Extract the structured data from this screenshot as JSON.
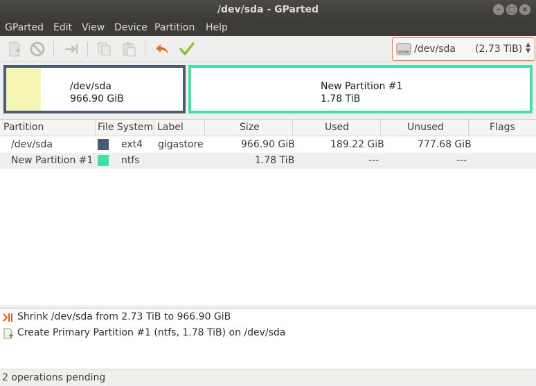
{
  "window": {
    "title": "/dev/sda - GParted"
  },
  "menu": {
    "items": [
      "GParted",
      "Edit",
      "View",
      "Device",
      "Partition",
      "Help"
    ]
  },
  "toolbar": {
    "icons": [
      "new-partition-icon",
      "delete-icon",
      "resize-move-icon",
      "copy-icon",
      "paste-icon",
      "undo-icon",
      "apply-icon"
    ]
  },
  "device_selector": {
    "name": "/dev/sda",
    "size": "(2.73 TiB)"
  },
  "disk_map": {
    "partitions": [
      {
        "name": "/dev/sda",
        "size": "966.90 GiB",
        "border_color": "#485b70",
        "used_fraction": 0.2
      },
      {
        "name": "New Partition #1",
        "size": "1.78 TiB",
        "border_color": "#43dfa8",
        "used_fraction": 0
      }
    ]
  },
  "table": {
    "columns": [
      "Partition",
      "File System",
      "Label",
      "Size",
      "Used",
      "Unused",
      "Flags"
    ],
    "rows": [
      {
        "partition": "/dev/sda",
        "fs_color": "#485b70",
        "filesystem": "ext4",
        "label": "gigastore",
        "size": "966.90 GiB",
        "used": "189.22 GiB",
        "unused": "777.68 GiB",
        "flags": ""
      },
      {
        "partition": "New Partition #1",
        "fs_color": "#43dfa8",
        "filesystem": "ntfs",
        "label": "",
        "size": "1.78 TiB",
        "used": "---",
        "unused": "---",
        "flags": ""
      }
    ]
  },
  "operations": {
    "items": [
      {
        "icon": "shrink-icon",
        "text": "Shrink /dev/sda from 2.73 TiB to 966.90 GiB"
      },
      {
        "icon": "create-partition-icon",
        "text": "Create Primary Partition #1 (ntfs, 1.78 TiB) on /dev/sda"
      }
    ]
  },
  "status": {
    "text": "2 operations pending"
  },
  "colors": {
    "titlebar": "#3c3b37",
    "accent": "#e97f4f",
    "ext4": "#485b70",
    "ntfs": "#43dfa8"
  }
}
